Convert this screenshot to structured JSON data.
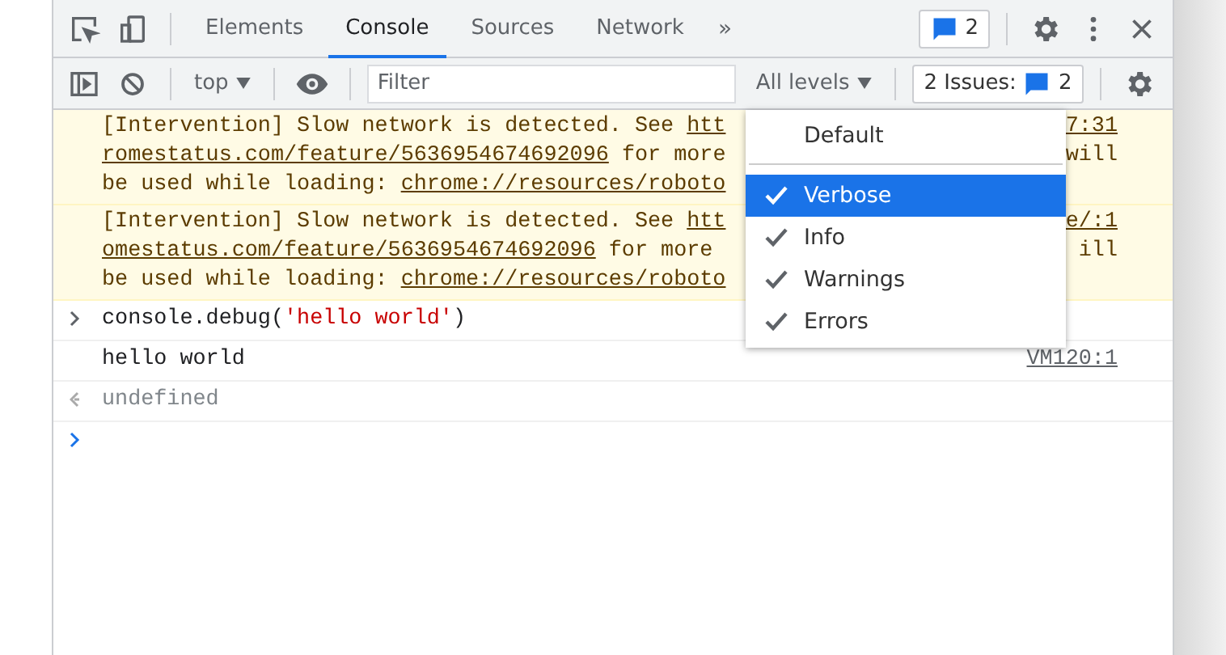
{
  "tabs": [
    {
      "label": "Elements",
      "selected": false
    },
    {
      "label": "Console",
      "selected": true
    },
    {
      "label": "Sources",
      "selected": false
    },
    {
      "label": "Network",
      "selected": false
    }
  ],
  "more_tabs": "»",
  "messages_badge": "2",
  "console_toolbar": {
    "context": "top",
    "filter": {
      "placeholder": "Filter"
    },
    "levels": "All levels",
    "issues_label": "2 Issues:",
    "issues_count": "2"
  },
  "entries": [
    {
      "kind": "warning",
      "lines": [
        {
          "parts": [
            {
              "text": "[Intervention] Slow network is detected. See ",
              "link": false
            },
            {
              "text": "htt",
              "link": true
            }
          ],
          "right": {
            "text": "7:31",
            "link": true
          }
        },
        {
          "parts": [
            {
              "text": "romestatus.com/feature/5636954674692096",
              "link": true
            },
            {
              "text": " for more",
              "link": false
            }
          ],
          "right": {
            "text": "will",
            "link": false
          }
        },
        {
          "parts": [
            {
              "text": "be used while loading: ",
              "link": false
            },
            {
              "text": "chrome://resources/roboto",
              "link": true
            }
          ]
        }
      ]
    },
    {
      "kind": "warning",
      "lines": [
        {
          "parts": [
            {
              "text": "[Intervention] Slow network is detected. See ",
              "link": false
            },
            {
              "text": "htt",
              "link": true
            }
          ],
          "right": {
            "text": "e/:1",
            "link": true
          }
        },
        {
          "parts": [
            {
              "text": "omestatus.com/feature/5636954674692096",
              "link": true
            },
            {
              "text": " for more",
              "link": false
            }
          ],
          "right": {
            "text": "ill",
            "link": false
          }
        },
        {
          "parts": [
            {
              "text": "be used while loading: ",
              "link": false
            },
            {
              "text": "chrome://resources/roboto",
              "link": true
            }
          ]
        }
      ]
    },
    {
      "kind": "input",
      "code": "console.debug(",
      "string": "'hello world'",
      "close": ")"
    },
    {
      "kind": "log",
      "text": "hello world",
      "source": "VM120:1"
    },
    {
      "kind": "result",
      "text": "undefined"
    },
    {
      "kind": "prompt"
    }
  ],
  "levels_menu": [
    {
      "label": "Default",
      "kind": "plain",
      "checked": false,
      "selected": false
    },
    {
      "kind": "divider"
    },
    {
      "label": "Verbose",
      "kind": "check",
      "checked": true,
      "selected": true
    },
    {
      "label": "Info",
      "kind": "check",
      "checked": true,
      "selected": false
    },
    {
      "label": "Warnings",
      "kind": "check",
      "checked": true,
      "selected": false
    },
    {
      "label": "Errors",
      "kind": "check",
      "checked": true,
      "selected": false
    }
  ]
}
